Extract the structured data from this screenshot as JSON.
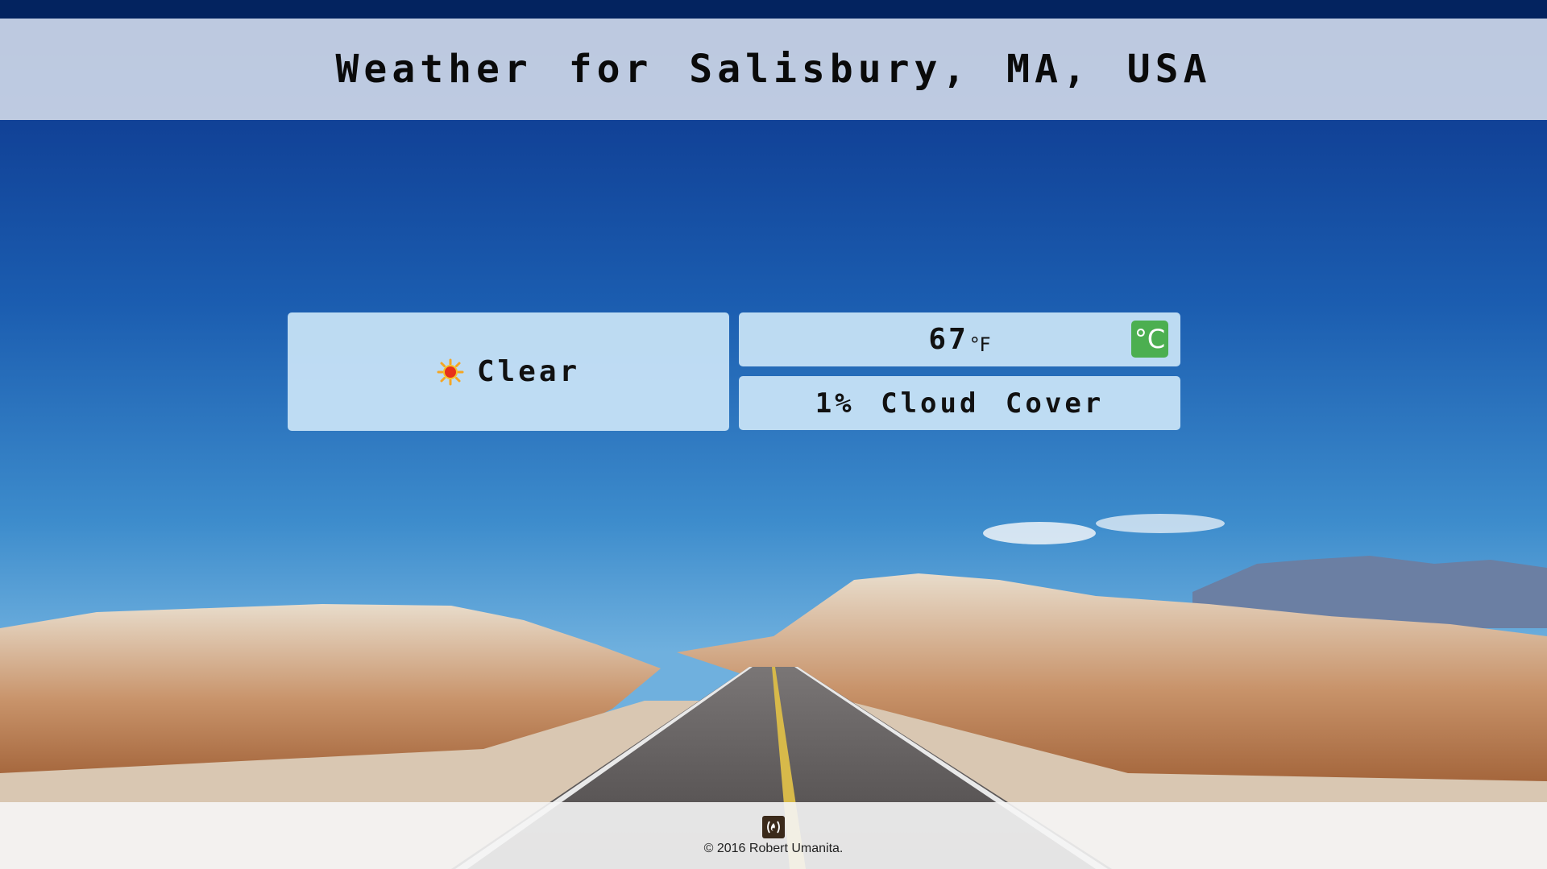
{
  "header": {
    "title": "Weather for Salisbury, MA, USA"
  },
  "weather": {
    "condition": "Clear",
    "condition_icon": "sun-icon",
    "temperature": "67",
    "temperature_unit": "°F",
    "toggle_unit_label": "°C",
    "cloud_cover": "1% Cloud Cover"
  },
  "footer": {
    "logo_icon": "freecodecamp-logo-icon",
    "copyright": "© 2016 Robert Umanita."
  },
  "colors": {
    "toggle_button": "#4caf50",
    "panel": "#c6e2f5",
    "topbar": "#03235f",
    "sky": "#1b4f9a"
  }
}
